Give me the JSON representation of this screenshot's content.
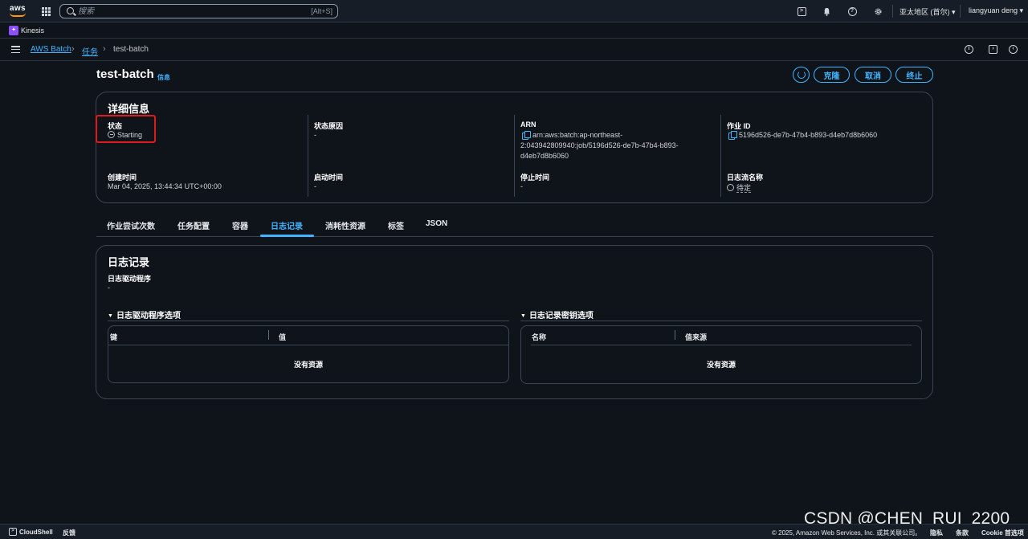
{
  "topnav": {
    "logo_text": "aws",
    "search_placeholder": "搜索",
    "search_shortcut": "[Alt+S]",
    "region": "亚太地区 (首尔) ▾",
    "user": "liangyuan deng ▾"
  },
  "service_bar": {
    "label": "Kinesis"
  },
  "breadcrumb": {
    "items": [
      "AWS Batch",
      "任务"
    ],
    "current": "test-batch"
  },
  "page": {
    "title": "test-batch",
    "info_link": "信息",
    "buttons": {
      "clone": "克隆",
      "cancel": "取消",
      "terminate": "终止"
    }
  },
  "details": {
    "heading": "详细信息",
    "fields": [
      {
        "label": "状态",
        "value": "Starting"
      },
      {
        "label": "状态原因",
        "value": "-"
      },
      {
        "label": "ARN",
        "value_lines": [
          "arn:aws:batch:ap-northeast-",
          "2:043942809940:job/5196d526-de7b-47b4-b893-",
          "d4eb7d8b6060"
        ]
      },
      {
        "label": "作业 ID",
        "value": "5196d526-de7b-47b4-b893-d4eb7d8b6060"
      },
      {
        "label": "创建时间",
        "value": "Mar 04, 2025, 13:44:34 UTC+00:00"
      },
      {
        "label": "启动时间",
        "value": "-"
      },
      {
        "label": "停止时间",
        "value": "-"
      },
      {
        "label": "日志流名称",
        "value": "待定"
      }
    ],
    "highlight_color": "#e0191f"
  },
  "tabs": [
    {
      "label": "作业尝试次数",
      "active": false
    },
    {
      "label": "任务配置",
      "active": false
    },
    {
      "label": "容器",
      "active": false
    },
    {
      "label": "日志记录",
      "active": true
    },
    {
      "label": "消耗性资源",
      "active": false
    },
    {
      "label": "标签",
      "active": false
    },
    {
      "label": "JSON",
      "active": false
    }
  ],
  "logs": {
    "heading": "日志记录",
    "driver_label": "日志驱动程序",
    "driver_value": "-",
    "driver_options": {
      "title": "日志驱动程序选项",
      "columns": [
        "键",
        "值"
      ],
      "empty": "没有资源"
    },
    "secret_options": {
      "title": "日志记录密钥选项",
      "columns": [
        "名称",
        "值来源"
      ],
      "empty": "没有资源"
    }
  },
  "footer": {
    "cloudshell": "CloudShell",
    "feedback": "反馈",
    "copyright": "© 2025, Amazon Web Services, Inc. 或其关联公司。",
    "privacy": "隐私",
    "terms": "条款",
    "cookie": "Cookie 首选项"
  },
  "watermark": "CSDN @CHEN_RUI_2200",
  "colors": {
    "accent": "#42b4ff",
    "background": "#0f141a",
    "nav": "#161d26",
    "border": "#3b4654"
  }
}
